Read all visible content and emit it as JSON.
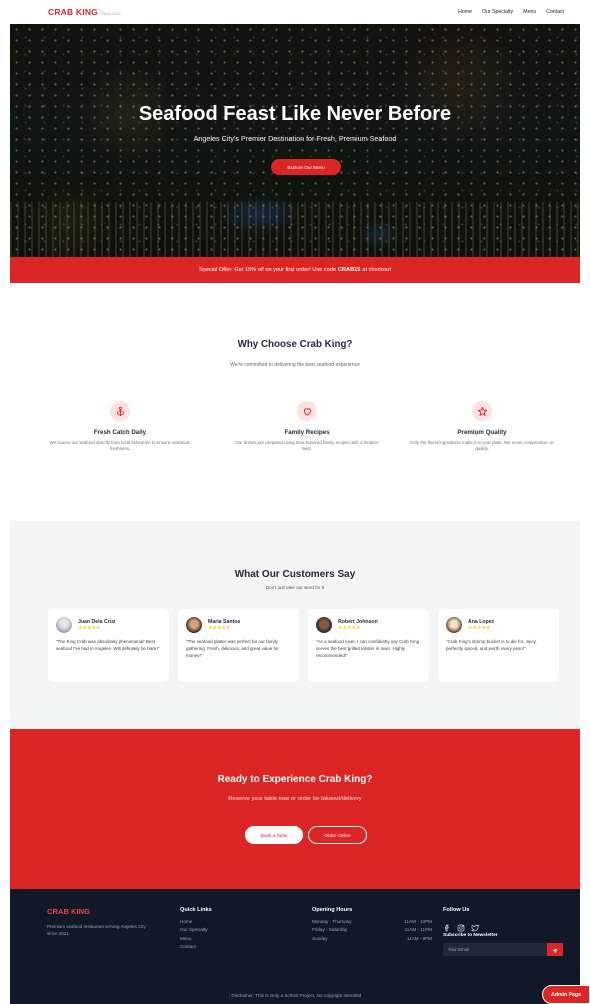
{
  "nav": {
    "brand": "CRAB KING",
    "since": "Since 2021",
    "links": [
      "Home",
      "Our Specialty",
      "Menu",
      "Contact"
    ]
  },
  "hero": {
    "title": "Seafood Feast Like Never Before",
    "subtitle": "Angeles City's Premier Destination for Fresh, Premium Seafood",
    "button": "Explore Our Menu"
  },
  "offer": {
    "prefix": "Special Offer: Get 15% off on your first order! Use code",
    "code": "CRAB15",
    "suffix": "at checkout"
  },
  "why": {
    "title": "Why Choose Crab King?",
    "subtitle": "We're committed to delivering the best seafood experience",
    "features": [
      {
        "icon": "anchor-icon",
        "title": "Fresh Catch Daily",
        "text": "We source our seafood directly from local fishermen to ensure maximum freshness."
      },
      {
        "icon": "heart-icon",
        "title": "Family Recipes",
        "text": "Our dishes are prepared using time-honored family recipes with a modern twist."
      },
      {
        "icon": "star-icon",
        "title": "Premium Quality",
        "text": "Only the finest ingredients make it to your plate. We never compromise on quality."
      }
    ]
  },
  "testimonials": {
    "title": "What Our Customers Say",
    "subtitle": "Don't just take our word for it",
    "rating_stars": "★★★★★",
    "items": [
      {
        "name": "Juan Dela Cruz",
        "rating": 5,
        "text": "\"The King Crab was absolutely phenomenal! Best seafood I've had in Angeles. Will definitely be back!\""
      },
      {
        "name": "Maria Santos",
        "rating": 5,
        "text": "\"The seafood platter was perfect for our family gathering. Fresh, delicious, and great value for money!\""
      },
      {
        "name": "Robert Johnson",
        "rating": 5,
        "text": "\"As a seafood lover, I can confidently say Crab King serves the best grilled lobster in town. Highly recommended!\""
      },
      {
        "name": "Ana Lopez",
        "rating": 5,
        "text": "\"Crab King's shrimp bucket is to die for. Juicy, perfectly spiced, and worth every peso!\""
      }
    ]
  },
  "cta": {
    "title": "Ready to Experience Crab King?",
    "subtitle": "Reserve your table now or order for takeout/delivery",
    "primary": "Book a Table",
    "secondary": "Order Online"
  },
  "footer": {
    "brand": "CRAB KING",
    "description": "Premium seafood restaurant serving Angeles City since 2021.",
    "quick_links_title": "Quick Links",
    "quick_links": [
      "Home",
      "Our Specialty",
      "Menu",
      "Contact"
    ],
    "hours_title": "Opening Hours",
    "hours": [
      {
        "days": "Monday - Thursday",
        "time": "11AM - 10PM"
      },
      {
        "days": "Friday - Saturday",
        "time": "11AM - 11PM"
      },
      {
        "days": "Sunday",
        "time": "11AM - 9PM"
      }
    ],
    "follow_title": "Follow Us",
    "social_icons": [
      "facebook-icon",
      "instagram-icon",
      "twitter-icon"
    ],
    "newsletter_title": "Subscribe to Newsletter",
    "email_placeholder": "Your Email",
    "disclaimer": "; Disclaimer: This is Only a School Project, No copyright intended"
  },
  "admin_button": "Admin Page",
  "colors": {
    "accent": "#dc2626",
    "footer_bg": "#111827",
    "section_bg": "#f3f4f6",
    "star": "#facc15"
  }
}
